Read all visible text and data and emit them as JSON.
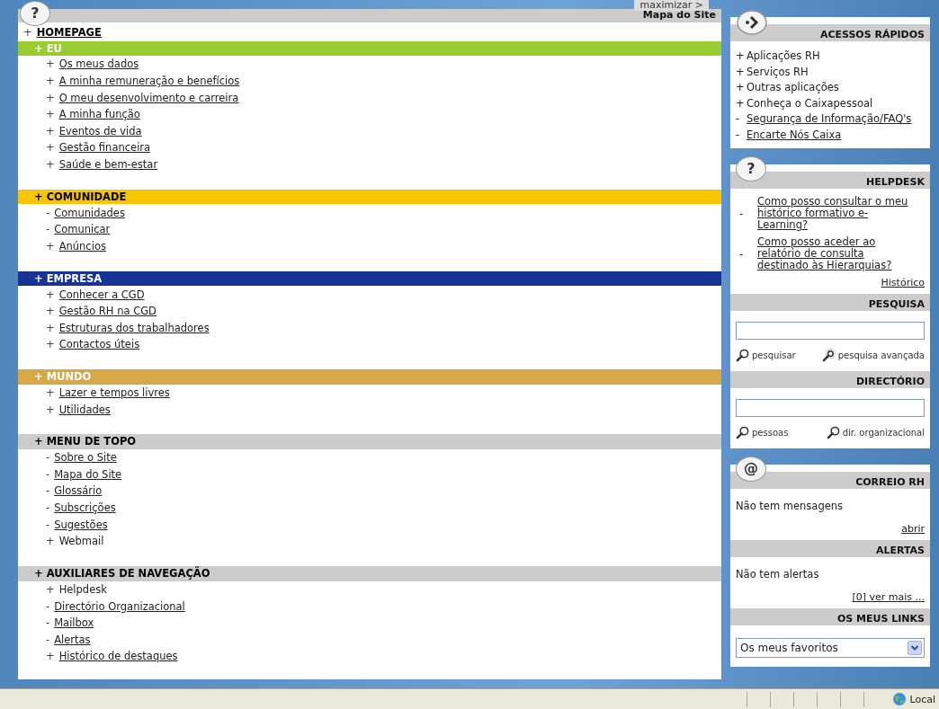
{
  "main": {
    "help_glyph": "?",
    "maximize_tab": "maximizar >",
    "title": "Mapa do Site",
    "homepage": {
      "marker": "+",
      "label": "HOMEPAGE"
    },
    "sections": [
      {
        "marker": "+",
        "title": "EU",
        "color": "#99cc33",
        "items": [
          {
            "marker": "+",
            "label": "Os meus dados",
            "link": true
          },
          {
            "marker": "+",
            "label": "A minha remuneração e benefícios",
            "link": true
          },
          {
            "marker": "+",
            "label": "O meu desenvolvimento e carreira",
            "link": true
          },
          {
            "marker": "+",
            "label": "A minha função",
            "link": true
          },
          {
            "marker": "+",
            "label": "Eventos de vida",
            "link": true
          },
          {
            "marker": "+",
            "label": "Gestão financeira",
            "link": true
          },
          {
            "marker": "+",
            "label": "Saúde e bem-estar",
            "link": true
          }
        ]
      },
      {
        "marker": "+",
        "title": "COMUNIDADE",
        "color": "#f7c600",
        "items": [
          {
            "marker": "-",
            "label": "Comunidades",
            "link": true
          },
          {
            "marker": "-",
            "label": "Comunicar",
            "link": true
          },
          {
            "marker": "+",
            "label": "Anúncios",
            "link": true
          }
        ]
      },
      {
        "marker": "+",
        "title": "EMPRESA",
        "color": "#173494",
        "items": [
          {
            "marker": "+",
            "label": "Conhecer a CGD",
            "link": true
          },
          {
            "marker": "+",
            "label": "Gestão RH na CGD",
            "link": true
          },
          {
            "marker": "+",
            "label": "Estruturas dos trabalhadores",
            "link": true
          },
          {
            "marker": "+",
            "label": "Contactos úteis",
            "link": true
          }
        ]
      },
      {
        "marker": "+",
        "title": "MUNDO",
        "color": "#d8a846",
        "items": [
          {
            "marker": "+",
            "label": "Lazer e tempos livres",
            "link": true
          },
          {
            "marker": "+",
            "label": "Utilidades",
            "link": true
          }
        ]
      },
      {
        "marker": "+",
        "title": "MENU DE TOPO",
        "color": "#cccccc",
        "items": [
          {
            "marker": "-",
            "label": "Sobre o Site",
            "link": true
          },
          {
            "marker": "-",
            "label": "Mapa do Site",
            "link": true
          },
          {
            "marker": "-",
            "label": "Glossário",
            "link": true
          },
          {
            "marker": "-",
            "label": "Subscrições",
            "link": true
          },
          {
            "marker": "-",
            "label": "Sugestões",
            "link": true
          },
          {
            "marker": "+",
            "label": "Webmail",
            "link": false
          }
        ]
      },
      {
        "marker": "+",
        "title": "AUXILIARES DE NAVEGAÇÃO",
        "color": "#cccccc",
        "items": [
          {
            "marker": "+",
            "label": "Helpdesk",
            "link": false
          },
          {
            "marker": "-",
            "label": "Directório Organizacional",
            "link": true
          },
          {
            "marker": "-",
            "label": "Mailbox",
            "link": true
          },
          {
            "marker": "-",
            "label": "Alertas",
            "link": true
          },
          {
            "marker": "+",
            "label": "Histórico de destaques",
            "link": true
          }
        ]
      }
    ]
  },
  "right_panels": [
    {
      "sections": [
        {
          "kind": "links",
          "title": "ACESSOS RÁPIDOS",
          "items": [
            {
              "marker": "+",
              "label": "Aplicações RH",
              "link": false
            },
            {
              "marker": "+",
              "label": "Serviços RH",
              "link": false
            },
            {
              "marker": "+",
              "label": "Outras aplicações",
              "link": false
            },
            {
              "marker": "+",
              "label": "Conheça o Caixapessoal",
              "link": false
            },
            {
              "marker": "-",
              "label": "Segurança de Informação/FAQ's",
              "link": true
            },
            {
              "marker": "-",
              "label": "Encarte Nós Caixa",
              "link": true
            }
          ]
        }
      ]
    },
    {
      "glyph": "?",
      "sections": [
        {
          "kind": "questions",
          "title": "HELPDESK",
          "items": [
            {
              "marker": "-",
              "label": "Como posso consultar o meu histórico formativo e-Learning?"
            },
            {
              "marker": "-",
              "label": "Como posso aceder ao relatório de consulta destinado às Hierarquias?"
            }
          ],
          "more": "Histórico"
        },
        {
          "kind": "search",
          "title": "PESQUISA",
          "actions": [
            {
              "label": "pesquisar"
            },
            {
              "label": "pesquisa avançada"
            }
          ]
        },
        {
          "kind": "directory",
          "title": "DIRECTÓRIO",
          "actions": [
            {
              "label": "pessoas"
            },
            {
              "label": "dir. organizacional"
            }
          ]
        }
      ]
    },
    {
      "glyph": "@",
      "sections": [
        {
          "kind": "message",
          "title": "CORREIO RH",
          "text": "Não tem mensagens",
          "more": "abrir"
        },
        {
          "kind": "message",
          "title": "ALERTAS",
          "text": "Não tem alertas",
          "more": "[0] ver mais ..."
        },
        {
          "kind": "select",
          "title": "OS MEUS LINKS",
          "value": "Os meus favoritos"
        }
      ]
    }
  ],
  "status_bar": {
    "zone": "Local"
  }
}
